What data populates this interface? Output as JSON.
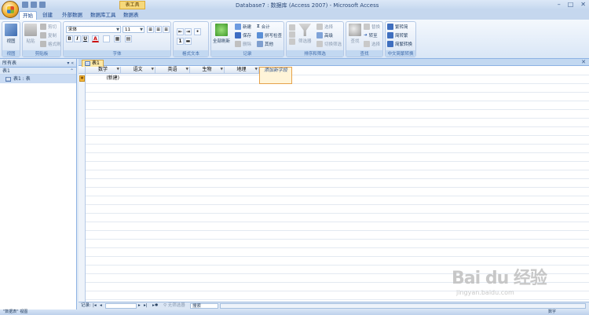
{
  "window": {
    "title": "Database7 : 数据库 (Access 2007) - Microsoft Access",
    "context_tab": "表工具",
    "controls": [
      "minimize",
      "maximize",
      "close"
    ]
  },
  "tabs": [
    "开始",
    "创建",
    "外部数据",
    "数据库工具",
    "数据表"
  ],
  "ribbon": {
    "view": {
      "label": "视图",
      "group": "视图"
    },
    "clipboard": {
      "paste": "粘贴",
      "cut": "剪切",
      "copy": "复制",
      "format_painter": "格式刷",
      "group": "剪贴板"
    },
    "font": {
      "family": "宋体",
      "size": "11",
      "group": "字体",
      "bold": "B",
      "italic": "I",
      "underline": "U",
      "font_color": "A"
    },
    "rich_text": {
      "group": "格式文本"
    },
    "records": {
      "refresh_all": "全部刷新",
      "new": "新建",
      "save": "保存",
      "delete": "删除",
      "totals": "合计",
      "spelling": "拼写检查",
      "more": "其他",
      "group": "记录"
    },
    "sort_filter": {
      "filter": "筛选器",
      "selection": "选择",
      "advanced": "高级",
      "toggle_filter": "切换筛选",
      "group": "排序和筛选"
    },
    "find": {
      "find": "查找",
      "replace": "替换",
      "goto": "转至",
      "select": "选择",
      "group": "查找"
    },
    "chinese": {
      "s2t": "繁转简",
      "t2s": "简转繁",
      "convert": "简繁转换",
      "group": "中文简繁转换"
    }
  },
  "nav_pane": {
    "header": "所有表",
    "group": "表1",
    "item": "表1 : 表"
  },
  "document": {
    "tab_label": "表1",
    "columns": [
      "数学",
      "语文",
      "英语",
      "生物",
      "地理"
    ],
    "add_field": "添加新字段",
    "new_row_label": "(新建)"
  },
  "record_bar": {
    "label": "记录:",
    "filter": "无筛选器",
    "search": "搜索"
  },
  "status": {
    "left": "\"数据表\" 视图",
    "right": "数字"
  },
  "watermark": {
    "brand": "Bai du 经验",
    "url": "jingyan.baidu.com"
  },
  "colors": {
    "accent": "#15428b",
    "ribbon_border": "#8db2e3",
    "context_tab": "#f6d87a"
  }
}
